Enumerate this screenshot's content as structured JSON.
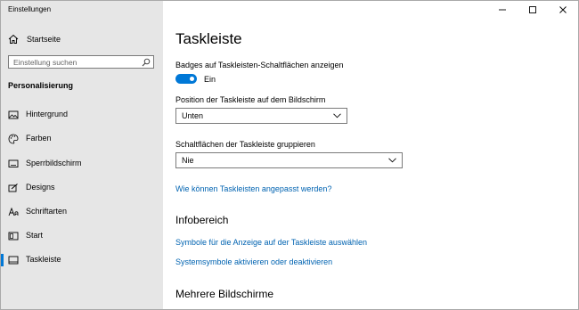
{
  "window": {
    "title": "Einstellungen"
  },
  "sidebar": {
    "home_label": "Startseite",
    "search_placeholder": "Einstellung suchen",
    "section_title": "Personalisierung",
    "items": [
      {
        "label": "Hintergrund",
        "icon": "picture-icon"
      },
      {
        "label": "Farben",
        "icon": "palette-icon"
      },
      {
        "label": "Sperrbildschirm",
        "icon": "lock-screen-icon"
      },
      {
        "label": "Designs",
        "icon": "designs-icon"
      },
      {
        "label": "Schriftarten",
        "icon": "font-icon"
      },
      {
        "label": "Start",
        "icon": "start-icon"
      },
      {
        "label": "Taskleiste",
        "icon": "taskbar-icon",
        "selected": true
      }
    ]
  },
  "main": {
    "title": "Taskleiste",
    "badges_label": "Badges auf Taskleisten-Schaltflächen anzeigen",
    "badges_toggle_state": "Ein",
    "position_label": "Position der Taskleiste auf dem Bildschirm",
    "position_value": "Unten",
    "group_label": "Schaltflächen der Taskleiste gruppieren",
    "group_value": "Nie",
    "customize_link": "Wie können Taskleisten angepasst werden?",
    "infobereich_heading": "Infobereich",
    "infobereich_links": [
      "Symbole für die Anzeige auf der Taskleiste auswählen",
      "Systemsymbole aktivieren oder deaktivieren"
    ],
    "multi_monitor_heading": "Mehrere Bildschirme"
  },
  "colors": {
    "accent": "#0078d7",
    "link": "#0063b1",
    "sidebar_bg": "#e6e6e6"
  }
}
